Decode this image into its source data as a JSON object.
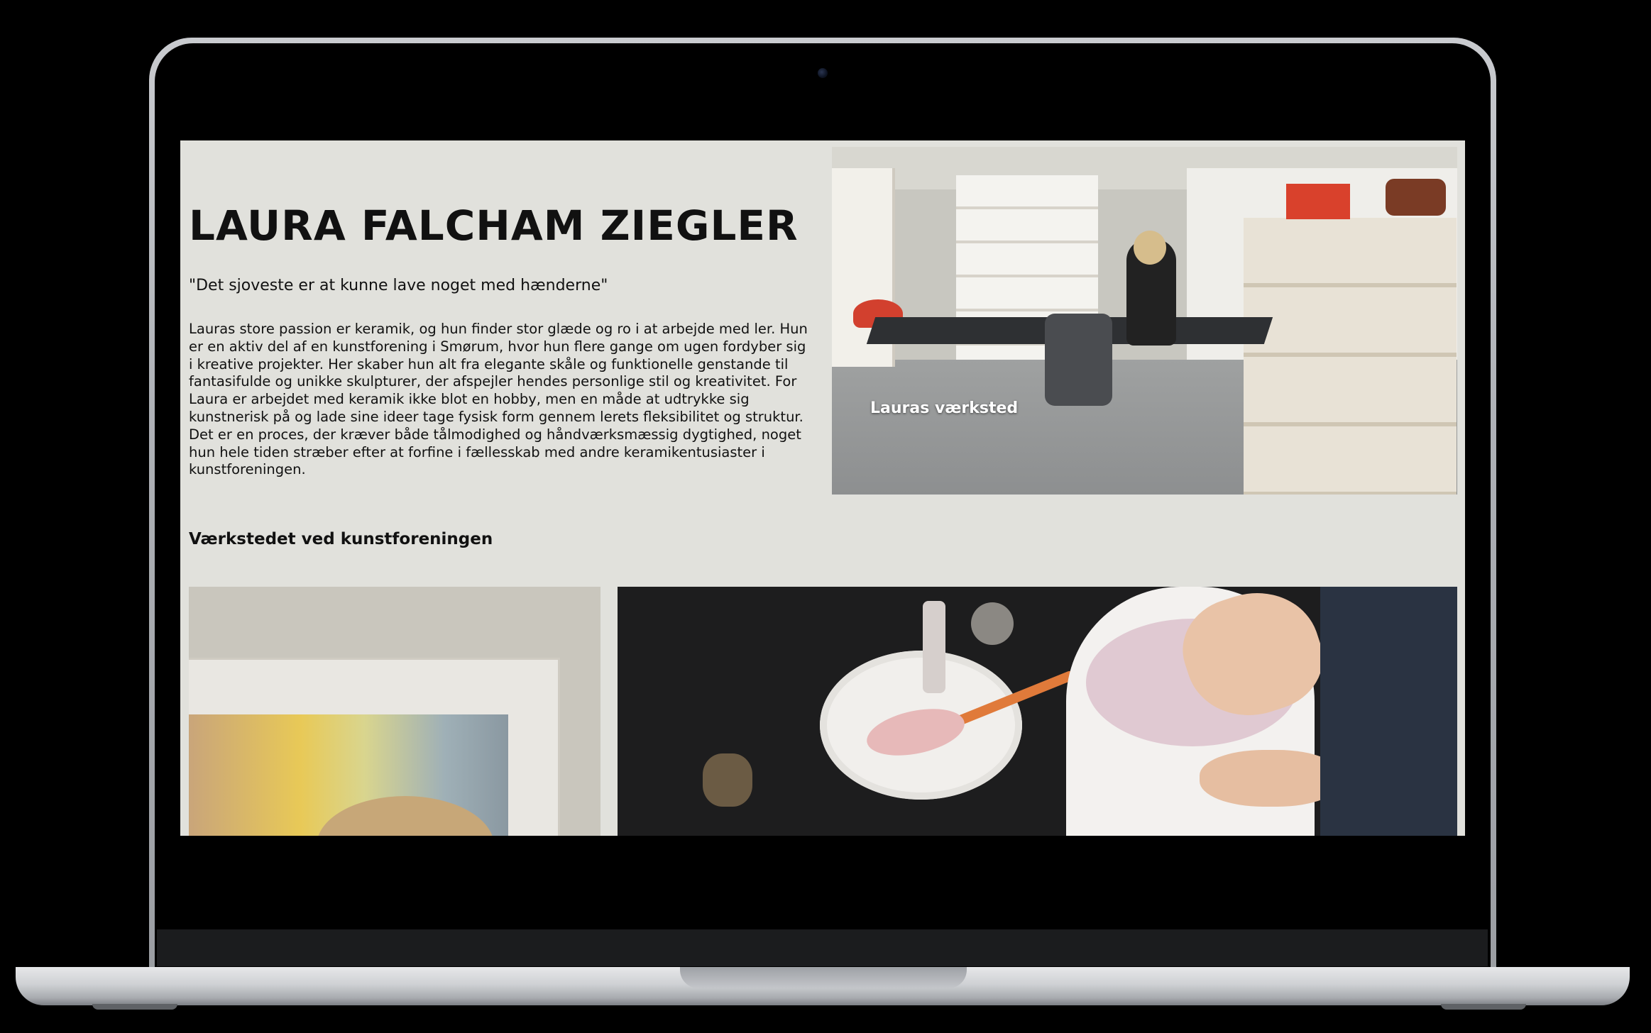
{
  "page": {
    "name": "LAURA FALCHAM ZIEGLER",
    "quote": "\"Det sjoveste er at kunne lave noget med hænderne\"",
    "bio": "Lauras store passion er keramik, og hun finder stor glæde og ro i at arbejde med ler. Hun er en aktiv del af en kunstforening i Smørum, hvor hun flere gange om ugen fordyber sig i kreative projekter. Her skaber hun alt fra elegante skåle og funktionelle genstande til fantasifulde og unikke skulpturer, der afspejler hendes personlige stil og kreativitet. For Laura er arbejdet med keramik ikke blot en hobby, men en måde at udtrykke sig kunstnerisk på og lade sine ideer tage fysisk form gennem lerets fleksibilitet og struktur. Det er en proces, der kræver både tålmodighed og håndværksmæssig dygtighed, noget hun hele tiden stræber efter at forfine i fællesskab med andre keramikentusiaster i kunstforeningen.",
    "workshop_caption": "Lauras værksted",
    "section_title": "Værkstedet ved kunstforeningen"
  },
  "colors": {
    "page_background": "#e1e1dc",
    "text": "#111111",
    "device_frame": "#000000"
  }
}
